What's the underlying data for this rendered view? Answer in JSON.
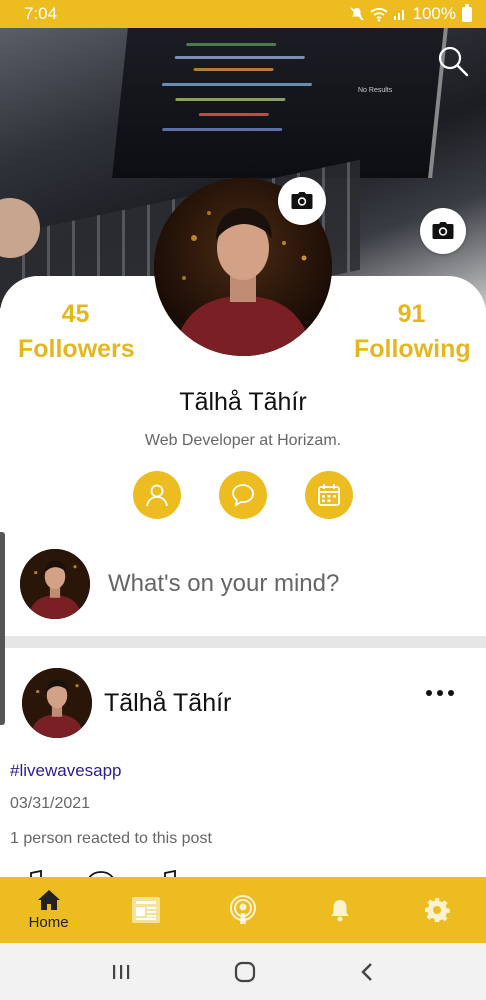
{
  "status_bar": {
    "time": "7:04",
    "battery": "100%"
  },
  "cover": {
    "screen_text": "No Results"
  },
  "profile": {
    "followers_count": "45",
    "followers_label": "Followers",
    "following_count": "91",
    "following_label": "Following",
    "name": "Tãlhå Tãhír",
    "bio": "Web Developer at Horizam."
  },
  "composer": {
    "placeholder": "What's on your mind?"
  },
  "post": {
    "author": "Tãlhå Tãhír",
    "hashtag": "#livewavesapp",
    "date": "03/31/2021",
    "reactions": "1 person reacted to this post"
  },
  "bottom_nav": {
    "items": [
      {
        "label": "Home",
        "icon": "home-icon",
        "active": true
      },
      {
        "label": "",
        "icon": "newspaper-icon"
      },
      {
        "label": "",
        "icon": "podcast-icon"
      },
      {
        "label": "",
        "icon": "bell-icon"
      },
      {
        "label": "",
        "icon": "gear-icon"
      }
    ]
  },
  "colors": {
    "accent": "#ECBC21",
    "stat_text": "#E5B71E",
    "hashtag": "#2a1f8f"
  }
}
